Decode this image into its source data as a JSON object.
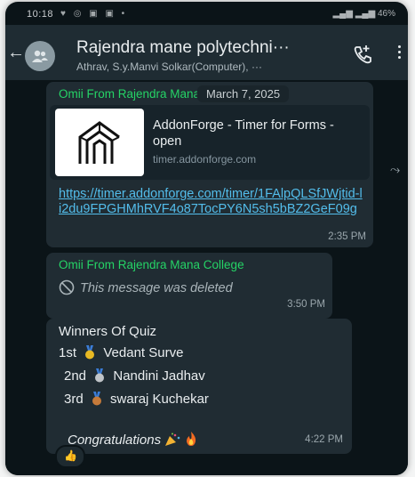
{
  "status_bar": {
    "time": "10:18",
    "battery": "46%"
  },
  "header": {
    "title": "Rajendra mane polytechni···",
    "subtitle": "Athrav, S.y.Manvi Solkar(Computer), ···",
    "back_icon": "arrow-left-icon",
    "call_icon": "phone-add-icon",
    "more_icon": "more-vertical-icon"
  },
  "chat": {
    "date_chip": "March 7, 2025",
    "messages": [
      {
        "sender": "Omii From Rajendra Mana College",
        "link_preview": {
          "title": "AddonForge - Timer for Forms  - open",
          "domain": "timer.addonforge.com"
        },
        "link": "https://timer.addonforge.com/timer/1FAlpQLSfJWjtid-li2du9FPGHMhRVF4o87TocPY6N5sh5bBZ2GeF09g",
        "time": "2:35 PM"
      },
      {
        "sender": "Omii From Rajendra Mana College",
        "deleted_text": "This message was deleted",
        "time": "3:50 PM"
      },
      {
        "heading": "Winners Of Quiz",
        "winners": [
          {
            "place": "1st",
            "name": "Vedant Surve"
          },
          {
            "place": "2nd",
            "name": "Nandini Jadhav"
          },
          {
            "place": "3rd",
            "name": "swaraj Kuchekar"
          }
        ],
        "closing": "Congratulations",
        "time": "4:22 PM",
        "reaction": "👍"
      }
    ]
  },
  "colors": {
    "background": "#0b1418",
    "header": "#1f2c33",
    "bubble": "#202c33",
    "sender": "#25d366",
    "link": "#53bdeb"
  }
}
